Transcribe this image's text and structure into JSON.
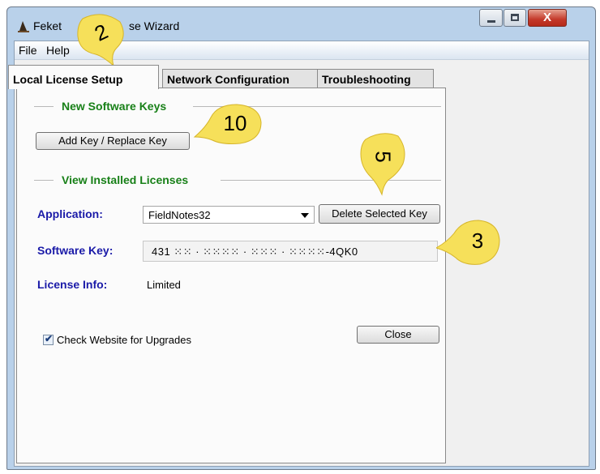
{
  "window": {
    "title_left": "Feket",
    "title_right": "se Wizard",
    "close_glyph": "X"
  },
  "menu": {
    "file": "File",
    "help": "Help"
  },
  "tabs": [
    {
      "label": "Local License Setup"
    },
    {
      "label": "Network Configuration"
    },
    {
      "label": "Troubleshooting"
    }
  ],
  "new_keys": {
    "group_title": "New Software Keys",
    "add_button": "Add Key / Replace Key"
  },
  "installed": {
    "group_title": "View Installed Licenses",
    "application_label": "Application:",
    "application_value": "FieldNotes32",
    "delete_button": "Delete Selected Key",
    "software_key_label": "Software Key:",
    "software_key_value": "431 ⁙⁙ · ⁙⁙⁙⁙ · ⁙⁙⁙ · ⁙⁙⁙⁙-4QK0",
    "license_info_label": "License Info:",
    "license_info_value": "Limited"
  },
  "footer": {
    "check_label": "Check Website for Upgrades",
    "checked": true,
    "close_button": "Close"
  },
  "callouts": [
    {
      "number": "2"
    },
    {
      "number": "10"
    },
    {
      "number": "5"
    },
    {
      "number": "3"
    }
  ],
  "colors": {
    "group_title": "#188018",
    "field_label": "#1a1aa8",
    "callout_fill": "#f6e05a"
  }
}
